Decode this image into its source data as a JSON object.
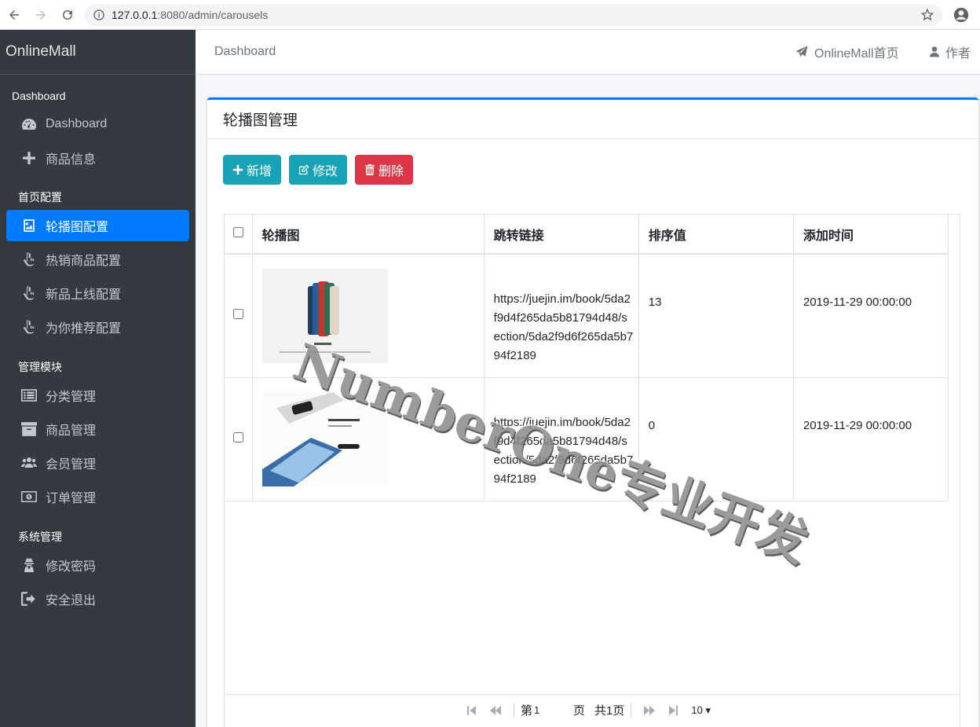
{
  "browser": {
    "url_host": "127.0.0.1",
    "url_path": ":8080/admin/carousels"
  },
  "sidebar": {
    "brand": "OnlineMall",
    "sections": [
      {
        "header": "Dashboard",
        "items": [
          {
            "label": "Dashboard",
            "icon": "tachometer-icon"
          },
          {
            "label": "商品信息",
            "icon": "plus-icon"
          }
        ]
      },
      {
        "header": "首页配置",
        "items": [
          {
            "label": "轮播图配置",
            "icon": "image-icon",
            "active": true
          },
          {
            "label": "热销商品配置",
            "icon": "hand-pointer-icon"
          },
          {
            "label": "新品上线配置",
            "icon": "hand-pointer-icon"
          },
          {
            "label": "为你推荐配置",
            "icon": "hand-pointer-icon"
          }
        ]
      },
      {
        "header": "管理模块",
        "items": [
          {
            "label": "分类管理",
            "icon": "list-icon"
          },
          {
            "label": "商品管理",
            "icon": "archive-icon"
          },
          {
            "label": "会员管理",
            "icon": "users-icon"
          },
          {
            "label": "订单管理",
            "icon": "money-bill-icon"
          }
        ]
      },
      {
        "header": "系统管理",
        "items": [
          {
            "label": "修改密码",
            "icon": "user-secret-icon"
          },
          {
            "label": "安全退出",
            "icon": "sign-out-icon"
          }
        ]
      }
    ]
  },
  "topbar": {
    "breadcrumb": "Dashboard",
    "home_link": "OnlineMall首页",
    "author_link": "作者"
  },
  "card": {
    "title": "轮播图管理",
    "buttons": {
      "add": "新增",
      "edit": "修改",
      "delete": "删除"
    }
  },
  "table": {
    "columns": [
      "轮播图",
      "跳转链接",
      "排序值",
      "添加时间"
    ],
    "rows": [
      {
        "image": "iPhone 12 carousel",
        "link": "https://juejin.im/book/5da2f9d4f265da5b81794d48/section/5da2f9d6f265da5b794f2189",
        "rank": "13",
        "time": "2019-11-29 00:00:00"
      },
      {
        "image": "HUAWEI P40 carousel",
        "link": "https://juejin.im/book/5da2f9d4f265da5b81794d48/section/5da2f9d6f265da5b794f2189",
        "rank": "0",
        "time": "2019-11-29 00:00:00"
      }
    ]
  },
  "pager": {
    "prefix": "第",
    "page": "1",
    "suffix": "页",
    "total": "共1页",
    "page_size": "10"
  },
  "watermark": "NumberOne专业开发",
  "colors": {
    "primary": "#007bff",
    "info": "#17a2b8",
    "danger": "#dc3545",
    "sidebar": "#343a40"
  }
}
